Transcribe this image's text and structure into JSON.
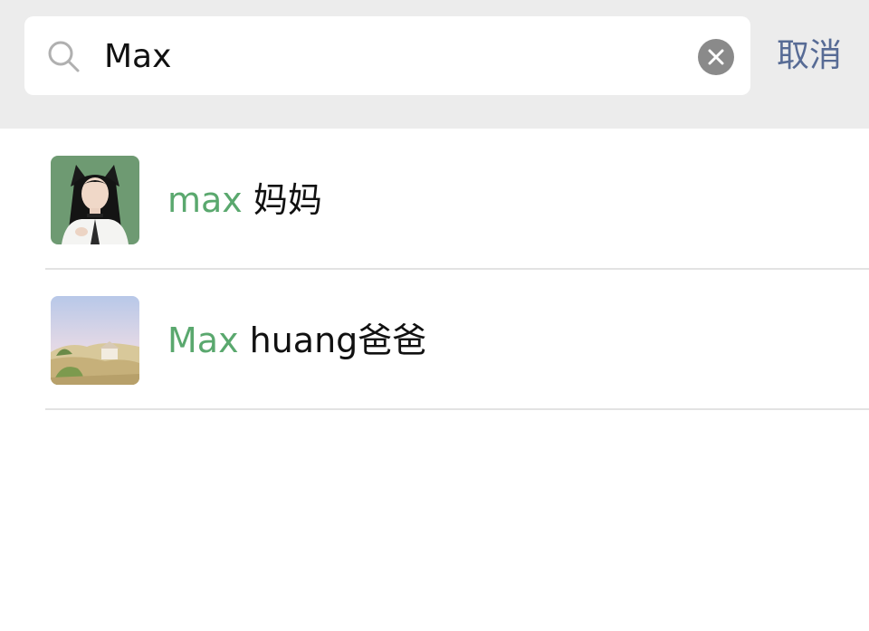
{
  "search": {
    "query": "Max",
    "cancel_label": "取消"
  },
  "icons": {
    "search": "search-icon",
    "clear": "clear-icon"
  },
  "colors": {
    "header_background": "#ececec",
    "highlight": "#5aa86e",
    "cancel_text": "#576b95",
    "clear_icon": "#8a8a8a"
  },
  "results": [
    {
      "highlight": "max",
      "rest": " 妈妈",
      "avatar": "woman-with-cat-ears-avatar"
    },
    {
      "highlight": "Max",
      "rest": " huang爸爸",
      "avatar": "landscape-painting-avatar"
    }
  ]
}
